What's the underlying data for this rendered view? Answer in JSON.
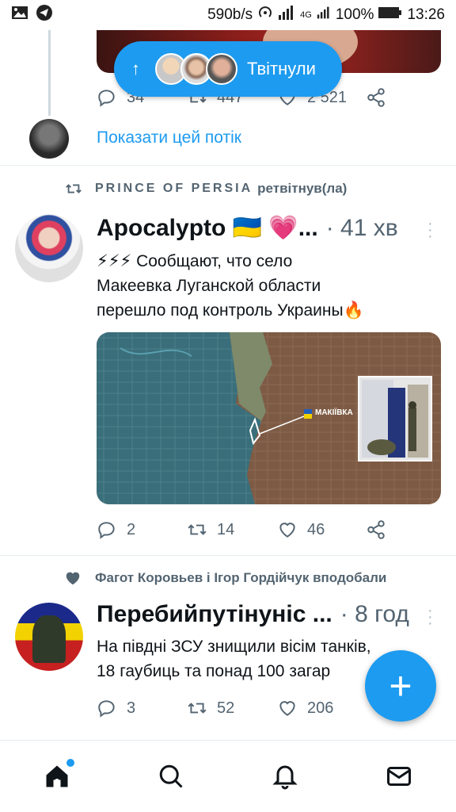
{
  "status_bar": {
    "speed": "590b/s",
    "network": "4G",
    "battery": "100%",
    "time": "13:26"
  },
  "thread": {
    "reply_count": "34",
    "retweet_count": "447",
    "like_count": "2 521",
    "show_thread": "Показати цей потік"
  },
  "pill": {
    "label": "Твітнули",
    "arrow": "↑"
  },
  "tweet1": {
    "retweeted_by_name": "PRINCE OF PERSIA",
    "retweeted_suffix": "ретвітнув(ла)",
    "author": "Apocalypto 🇺🇦 💗...",
    "time": "· 41 хв",
    "text_line1": "⚡⚡⚡ Сообщают, что село",
    "text_line2": "Макеевка Луганской области",
    "text_line3": "перешло под контроль Украины🔥",
    "map_label": "МАКІЇВКА",
    "reply_count": "2",
    "retweet_count": "14",
    "like_count": "46"
  },
  "tweet2": {
    "liked_by": "Фагот Коровьев і Ігор Гордійчук вподобали",
    "author": "Перебийпутінуніс ...",
    "time": "· 8 год",
    "text_line1": "На півдні ЗСУ знищили вісім танків,",
    "text_line2": "18 гаубиць та понад 100 загар",
    "reply_count": "3",
    "retweet_count": "52",
    "like_count": "206"
  },
  "fab": {
    "label": "+"
  },
  "nav": [
    "home-icon",
    "search-icon",
    "bell-icon",
    "mail-icon"
  ],
  "colors": {
    "accent": "#1d9bf0",
    "muted": "#536471"
  }
}
